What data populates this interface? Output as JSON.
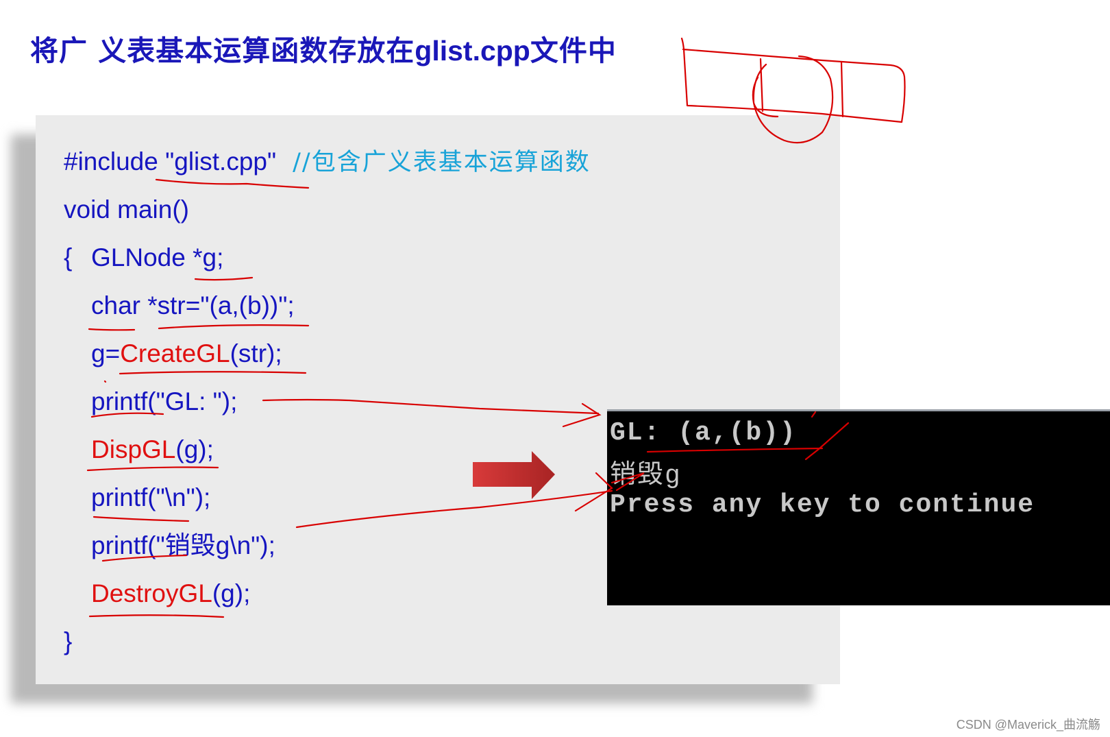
{
  "title": {
    "prefix": "将广 义表基本运算函数存放在",
    "filename": "glist.cpp",
    "suffix": "文件中"
  },
  "code": {
    "include_directive": "#include ",
    "include_file": "\"glist.cpp\"",
    "include_comment": "//包含广义表基本运算函数",
    "main_signature": "void main()",
    "open_brace": "{",
    "decl_node": "GLNode *g;",
    "decl_str": "char *str=\"(a,(b))\";",
    "create_lhs": "g=",
    "create_fn": "CreateGL",
    "create_args": "(str);",
    "printf_gl": "printf(\"GL: \");",
    "disp_fn": "DispGL",
    "disp_args": "(g);",
    "printf_newline": "printf(\"\\n\");",
    "printf_destroy": "printf(\"销毁g\\n\");",
    "destroy_fn": "DestroyGL",
    "destroy_args": "(g);",
    "close_brace": "}"
  },
  "terminal": {
    "lines": [
      "GL: (a,(b))",
      "销毁g",
      "Press any key to continue"
    ]
  },
  "annotations": {
    "arrow_color": "#d42a2a",
    "ink_color": "#e00000"
  },
  "watermark": "CSDN @Maverick_曲流觞"
}
